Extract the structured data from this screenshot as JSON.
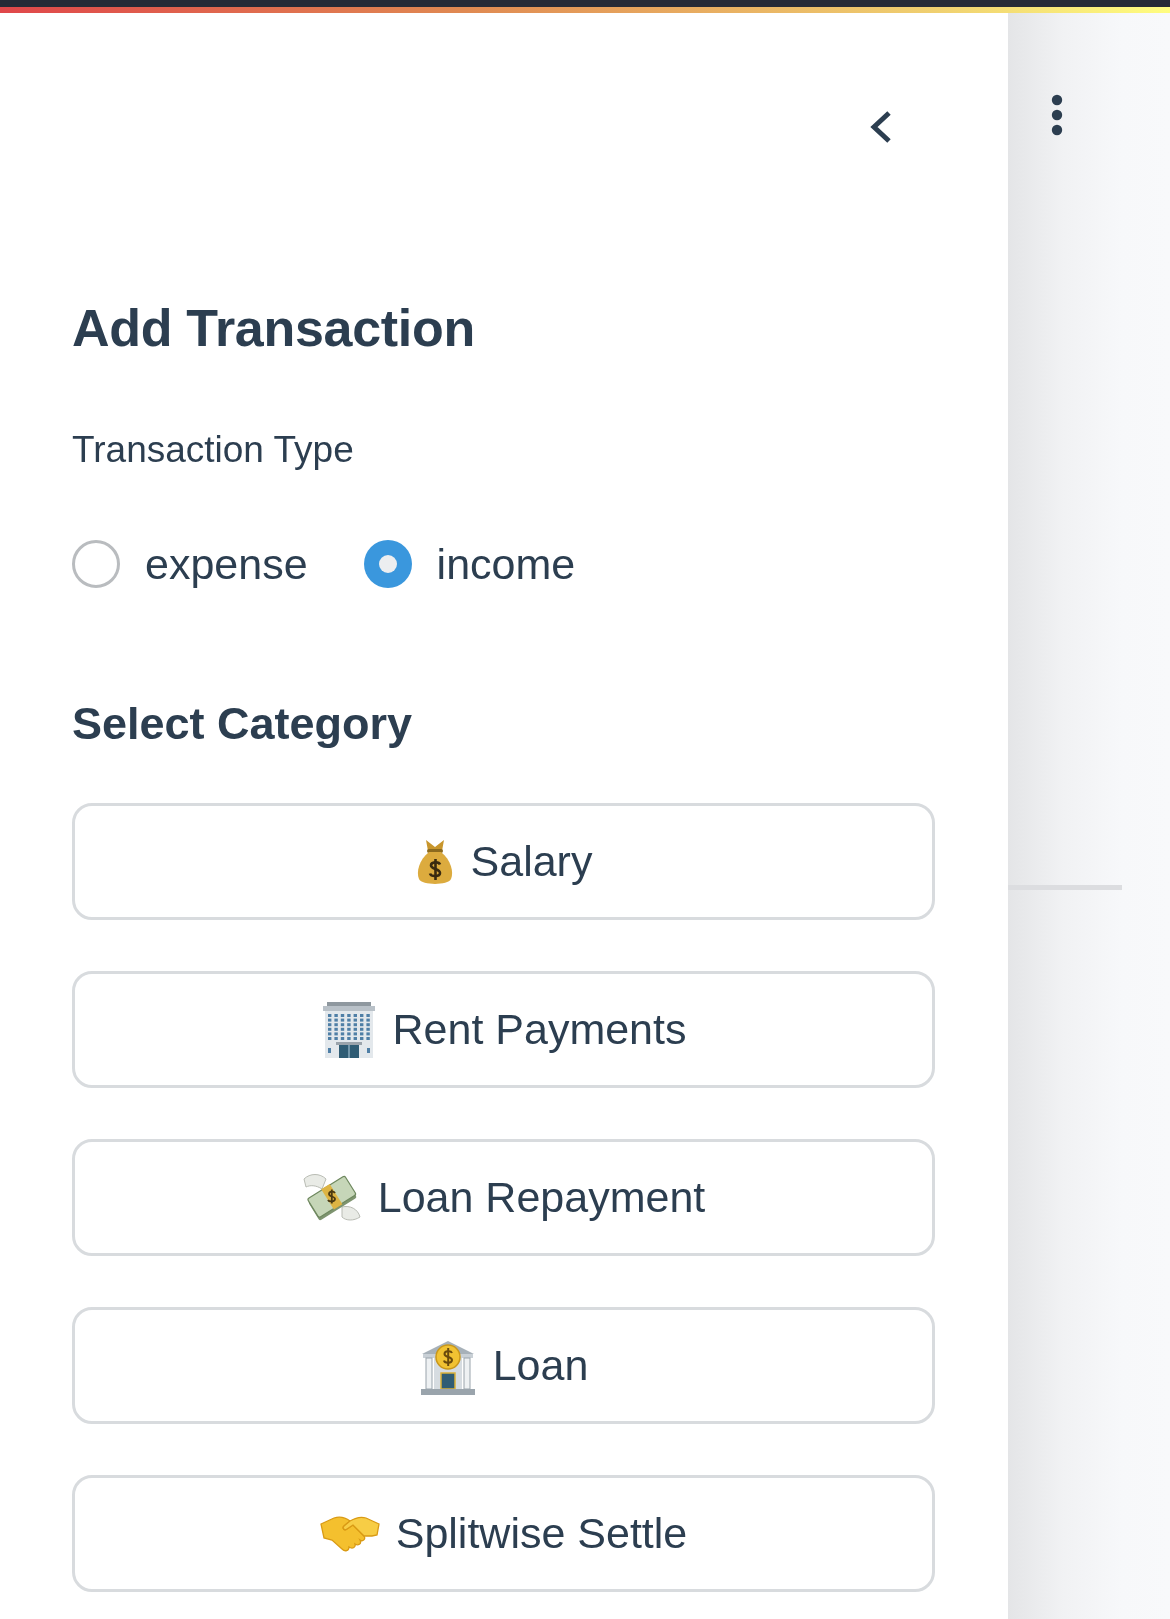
{
  "sidebar": {
    "title": "Add Transaction",
    "transaction_type": {
      "label": "Transaction Type",
      "options": [
        {
          "label": "expense",
          "selected": false
        },
        {
          "label": "income",
          "selected": true
        }
      ]
    },
    "category": {
      "heading": "Select Category",
      "buttons": [
        {
          "kind": "salary",
          "label": "Salary"
        },
        {
          "kind": "rent",
          "label": "Rent Payments"
        },
        {
          "kind": "repayment",
          "label": "Loan Repayment"
        },
        {
          "kind": "loan",
          "label": "Loan"
        },
        {
          "kind": "settle",
          "label": "Splitwise Settle"
        }
      ]
    }
  }
}
